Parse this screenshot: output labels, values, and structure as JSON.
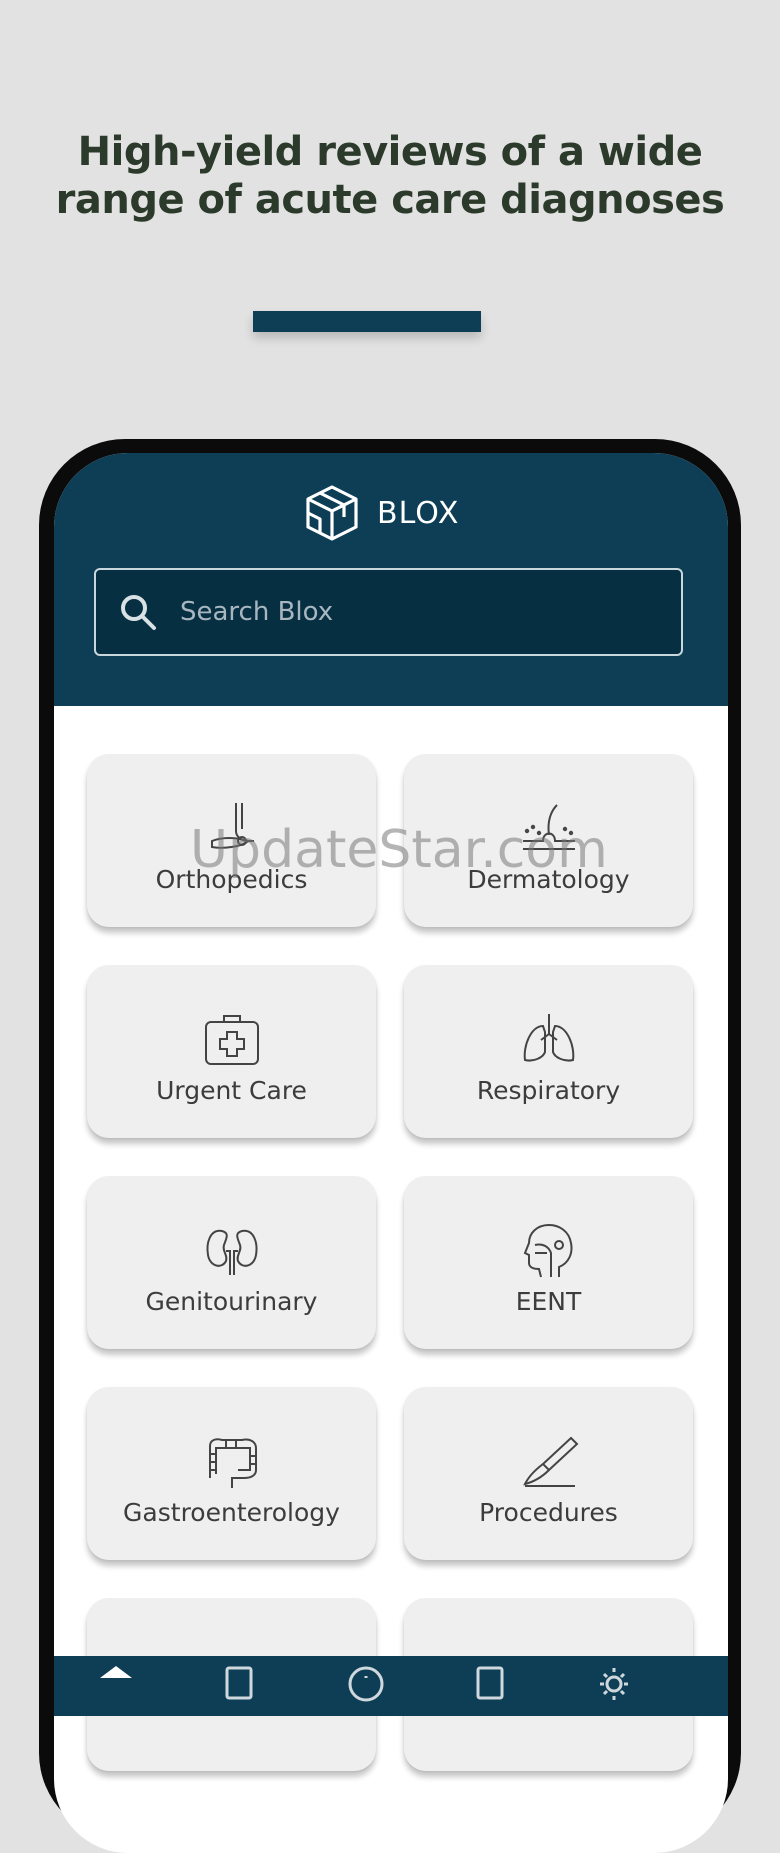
{
  "promo": {
    "headline": "High-yield reviews of a wide range of acute care diagnoses"
  },
  "app": {
    "brand": "BLOX",
    "search": {
      "placeholder": "Search Blox"
    },
    "categories": [
      {
        "label": "Orthopedics",
        "icon": "orthopedics-icon"
      },
      {
        "label": "Dermatology",
        "icon": "dermatology-icon"
      },
      {
        "label": "Urgent Care",
        "icon": "first-aid-kit-icon"
      },
      {
        "label": "Respiratory",
        "icon": "lungs-icon"
      },
      {
        "label": "Genitourinary",
        "icon": "kidneys-icon"
      },
      {
        "label": "EENT",
        "icon": "head-profile-icon"
      },
      {
        "label": "Gastroenterology",
        "icon": "intestines-icon"
      },
      {
        "label": "Procedures",
        "icon": "scalpel-icon"
      },
      {
        "label": "",
        "icon": "heart-icon"
      },
      {
        "label": "",
        "icon": "brain-icon"
      }
    ],
    "bottom_nav": [
      {
        "name": "home",
        "icon": "home-icon",
        "active": true
      },
      {
        "name": "bookmarks",
        "icon": "bookmark-icon"
      },
      {
        "name": "info",
        "icon": "info-icon"
      },
      {
        "name": "saved",
        "icon": "bookmark-outline-icon"
      },
      {
        "name": "settings",
        "icon": "gear-icon"
      }
    ]
  },
  "watermark": "UpdateStar.com",
  "colors": {
    "background": "#e2e2e2",
    "brand_navy": "#0e3e56",
    "headline_text": "#2b3a2a",
    "tile_background": "#efefef"
  }
}
